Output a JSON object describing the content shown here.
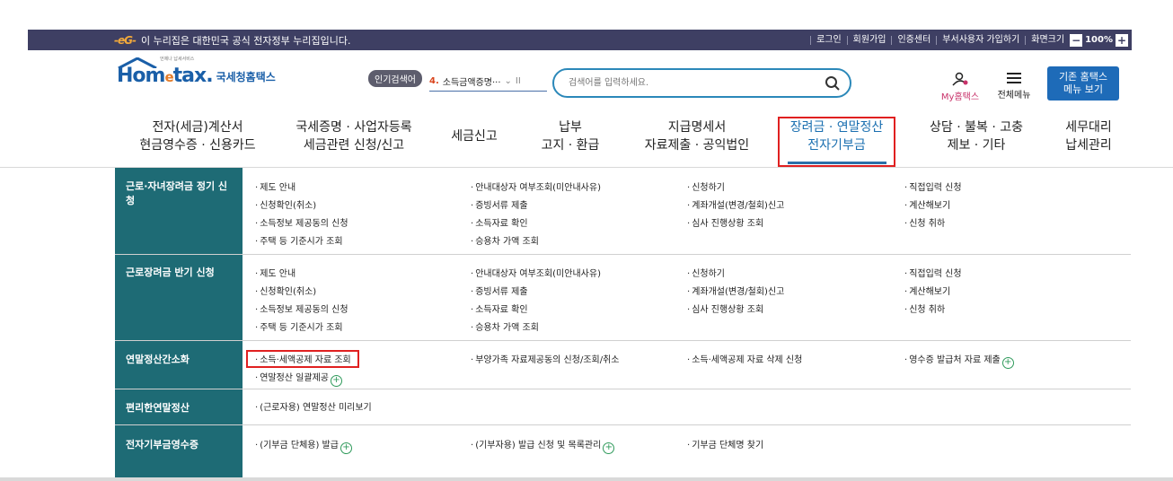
{
  "topbar": {
    "gov_logo": "-eG-",
    "gov_notice": "이 누리집은 대한민국 공식 전자정부 누리집입니다.",
    "util_links": [
      "로그인",
      "회원가입",
      "인증센터",
      "부서사용자 가입하기",
      "화면크기"
    ],
    "zoom_minus": "−",
    "zoom_value": "100%",
    "zoom_plus": "+"
  },
  "header": {
    "logo_small": "언제나 납세서비스",
    "logo_brand_a": "Hom",
    "logo_brand_e": "e",
    "logo_brand_b": "tax.",
    "logo_sub": "국세청홈택스",
    "popular_label": "인기검색어",
    "ranking_num": "4.",
    "ranking_text": "소득금액증명···",
    "ranking_sep": "II",
    "search_placeholder": "검색어를 입력하세요.",
    "my_home": "My홈택스",
    "all_menu": "전체메뉴",
    "old_menu_line1": "기존 홈택스",
    "old_menu_line2": "메뉴 보기"
  },
  "gnb": [
    {
      "line1": "전자(세금)계산서",
      "line2": "현금영수증 · 신용카드"
    },
    {
      "line1": "국세증명 · 사업자등록",
      "line2": "세금관련 신청/신고"
    },
    {
      "line1": "세금신고",
      "line2": ""
    },
    {
      "line1": "납부",
      "line2": "고지 · 환급"
    },
    {
      "line1": "지급명세서",
      "line2": "자료제출 · 공익법인"
    },
    {
      "line1": "장려금 · 연말정산",
      "line2": "전자기부금"
    },
    {
      "line1": "상담 · 불복 · 고충",
      "line2": "제보 · 기타"
    },
    {
      "line1": "세무대리",
      "line2": "납세관리"
    }
  ],
  "mega": {
    "rows": [
      {
        "title": "근로·자녀장려금 정기 신청",
        "links": [
          [
            "제도 안내",
            "신청확인(취소)",
            "소득정보 제공동의 신청",
            "주택 등 기준시가 조회"
          ],
          [
            "안내대상자 여부조회(미안내사유)",
            "증빙서류 제출",
            "소득자료 확인",
            "승용차 가액 조회"
          ],
          [
            "신청하기",
            "계좌개설(변경/철회)신고",
            "심사 진행상황 조회"
          ],
          [
            "직접입력 신청",
            "계산해보기",
            "신청 취하"
          ]
        ]
      },
      {
        "title": "근로장려금 반기 신청",
        "links": [
          [
            "제도 안내",
            "신청확인(취소)",
            "소득정보 제공동의 신청",
            "주택 등 기준시가 조회"
          ],
          [
            "안내대상자 여부조회(미안내사유)",
            "증빙서류 제출",
            "소득자료 확인",
            "승용차 가액 조회"
          ],
          [
            "신청하기",
            "계좌개설(변경/철회)신고",
            "심사 진행상황 조회"
          ],
          [
            "직접입력 신청",
            "계산해보기",
            "신청 취하"
          ]
        ]
      },
      {
        "title": "연말정산간소화",
        "links": [
          [
            "소득·세액공제 자료 조회",
            "연말정산 일괄제공"
          ],
          [
            "부양가족 자료제공동의 신청/조회/취소"
          ],
          [
            "소득·세액공제 자료 삭제 신청"
          ],
          [
            "영수증 발급처 자료 제출"
          ]
        ]
      },
      {
        "title": "편리한연말정산",
        "links": [
          [
            "(근로자용) 연말정산 미리보기"
          ]
        ]
      },
      {
        "title": "전자기부금영수증",
        "links": [
          [
            "(기부금 단체용) 발급"
          ],
          [
            "(기부자용) 발급 신청 및 목록관리"
          ],
          [
            "기부금 단체명 찾기"
          ]
        ]
      }
    ]
  },
  "colors": {
    "topbar": "#3e3f63",
    "side": "#1e6b75",
    "accent": "#1a6fb0",
    "highlight": "#e02020"
  }
}
